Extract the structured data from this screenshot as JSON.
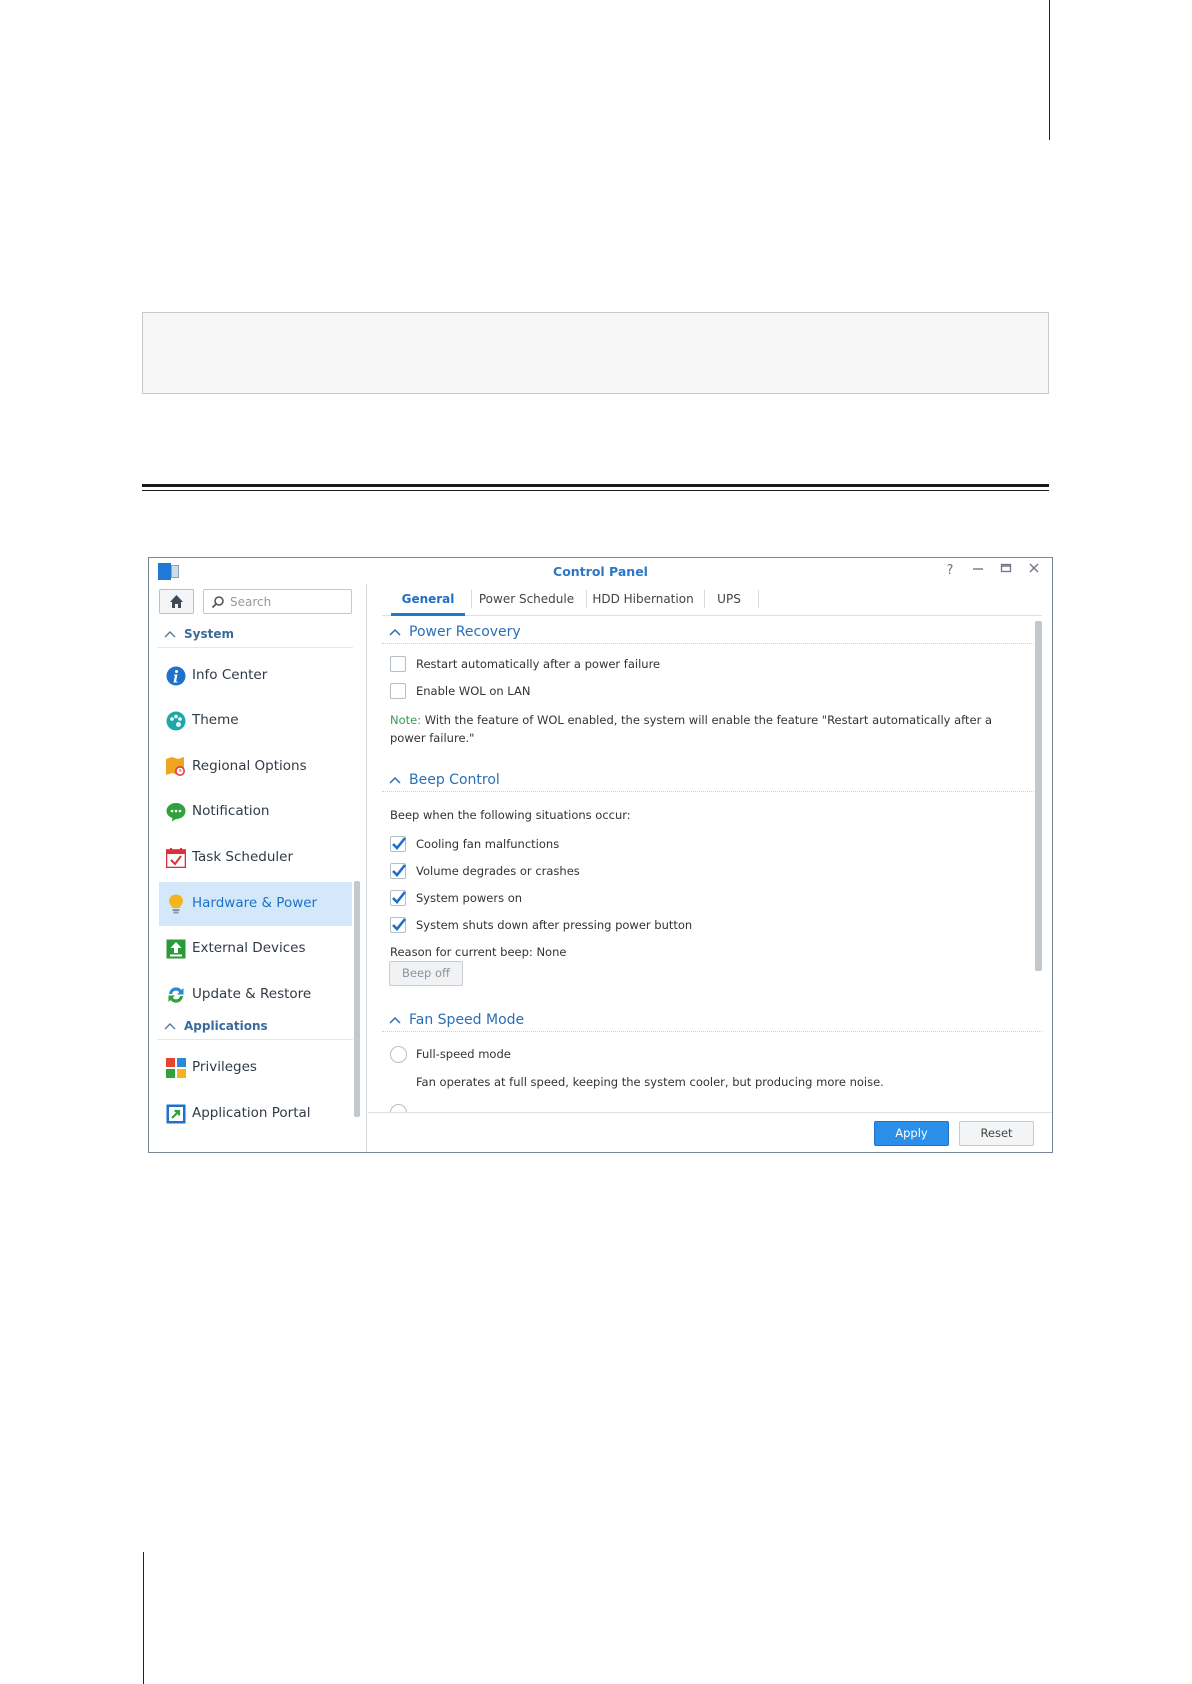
{
  "window": {
    "title": "Control Panel"
  },
  "sidebar": {
    "search_placeholder": "Search",
    "groups": [
      {
        "label": "System"
      },
      {
        "label": "Applications"
      }
    ],
    "items": [
      {
        "label": "Info Center",
        "icon": "info-icon"
      },
      {
        "label": "Theme",
        "icon": "palette-icon"
      },
      {
        "label": "Regional Options",
        "icon": "map-clock-icon"
      },
      {
        "label": "Notification",
        "icon": "chat-bubble-icon"
      },
      {
        "label": "Task Scheduler",
        "icon": "calendar-check-icon"
      },
      {
        "label": "Hardware & Power",
        "icon": "lightbulb-icon",
        "active": true
      },
      {
        "label": "External Devices",
        "icon": "upload-arrow-icon"
      },
      {
        "label": "Update & Restore",
        "icon": "refresh-icon"
      },
      {
        "label": "Privileges",
        "icon": "blocks-icon"
      },
      {
        "label": "Application Portal",
        "icon": "portal-arrow-icon"
      }
    ]
  },
  "tabs": [
    {
      "label": "General",
      "active": true
    },
    {
      "label": "Power Schedule"
    },
    {
      "label": "HDD Hibernation"
    },
    {
      "label": "UPS"
    }
  ],
  "power_recovery": {
    "title": "Power Recovery",
    "options": [
      {
        "label": "Restart automatically after a power failure",
        "checked": false
      },
      {
        "label": "Enable WOL on LAN",
        "checked": false
      }
    ],
    "note_prefix": "Note:",
    "note_text": " With the feature of WOL enabled, the system will enable the feature \"Restart automatically after a power failure.\""
  },
  "beep_control": {
    "title": "Beep Control",
    "intro": "Beep when the following situations occur:",
    "options": [
      {
        "label": "Cooling fan malfunctions",
        "checked": true
      },
      {
        "label": "Volume degrades or crashes",
        "checked": true
      },
      {
        "label": "System powers on",
        "checked": true
      },
      {
        "label": "System shuts down after pressing power button",
        "checked": true
      }
    ],
    "reason": "Reason for current beep: None",
    "beep_off_label": "Beep off"
  },
  "fan_speed": {
    "title": "Fan Speed Mode",
    "option_label": "Full-speed mode",
    "option_desc": "Fan operates at full speed, keeping the system cooler, but producing more noise."
  },
  "footer": {
    "apply_label": "Apply",
    "reset_label": "Reset"
  },
  "colors": {
    "accent": "#2b8ee8",
    "active_bg": "#d3e9fb",
    "note_green": "#3a9a55"
  }
}
